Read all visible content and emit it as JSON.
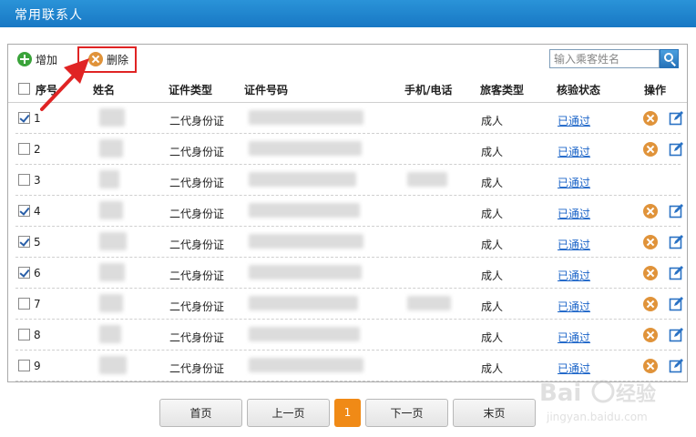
{
  "window": {
    "title": "常用联系人"
  },
  "toolbar": {
    "add_label": "增加",
    "delete_label": "删除",
    "search_placeholder": "输入乘客姓名"
  },
  "table": {
    "headers": {
      "seq": "序号",
      "name": "姓名",
      "id_type": "证件类型",
      "id_number": "证件号码",
      "phone": "手机/电话",
      "passenger_type": "旅客类型",
      "status": "核验状态",
      "actions": "操作"
    },
    "rows": [
      {
        "seq": "1",
        "checked": true,
        "id_type": "二代身份证",
        "passenger_type": "成人",
        "status": "已通过",
        "actions": true
      },
      {
        "seq": "2",
        "checked": false,
        "id_type": "二代身份证",
        "passenger_type": "成人",
        "status": "已通过",
        "actions": true
      },
      {
        "seq": "3",
        "checked": false,
        "id_type": "二代身份证",
        "passenger_type": "成人",
        "status": "已通过",
        "actions": false
      },
      {
        "seq": "4",
        "checked": true,
        "id_type": "二代身份证",
        "passenger_type": "成人",
        "status": "已通过",
        "actions": true
      },
      {
        "seq": "5",
        "checked": true,
        "id_type": "二代身份证",
        "passenger_type": "成人",
        "status": "已通过",
        "actions": true
      },
      {
        "seq": "6",
        "checked": true,
        "id_type": "二代身份证",
        "passenger_type": "成人",
        "status": "已通过",
        "actions": true
      },
      {
        "seq": "7",
        "checked": false,
        "id_type": "二代身份证",
        "passenger_type": "成人",
        "status": "已通过",
        "actions": true
      },
      {
        "seq": "8",
        "checked": false,
        "id_type": "二代身份证",
        "passenger_type": "成人",
        "status": "已通过",
        "actions": true
      },
      {
        "seq": "9",
        "checked": false,
        "id_type": "二代身份证",
        "passenger_type": "成人",
        "status": "已通过",
        "actions": true
      }
    ]
  },
  "pager": {
    "first": "首页",
    "prev": "上一页",
    "current": "1",
    "next": "下一页",
    "last": "末页"
  },
  "watermark": {
    "brand": "Baidu经验",
    "url": "jingyan.baidu.com"
  },
  "colors": {
    "titlebar": "#1f86cf",
    "add_icon": "#3aa33a",
    "delete_icon": "#e0933a",
    "highlight": "#e02424",
    "link": "#1b64c8",
    "current_page": "#f08a16"
  },
  "icons": {
    "add": "plus-circle-icon",
    "delete": "x-circle-icon",
    "search": "magnifier-icon",
    "edit": "edit-icon",
    "arrow": "red-arrow-icon"
  }
}
